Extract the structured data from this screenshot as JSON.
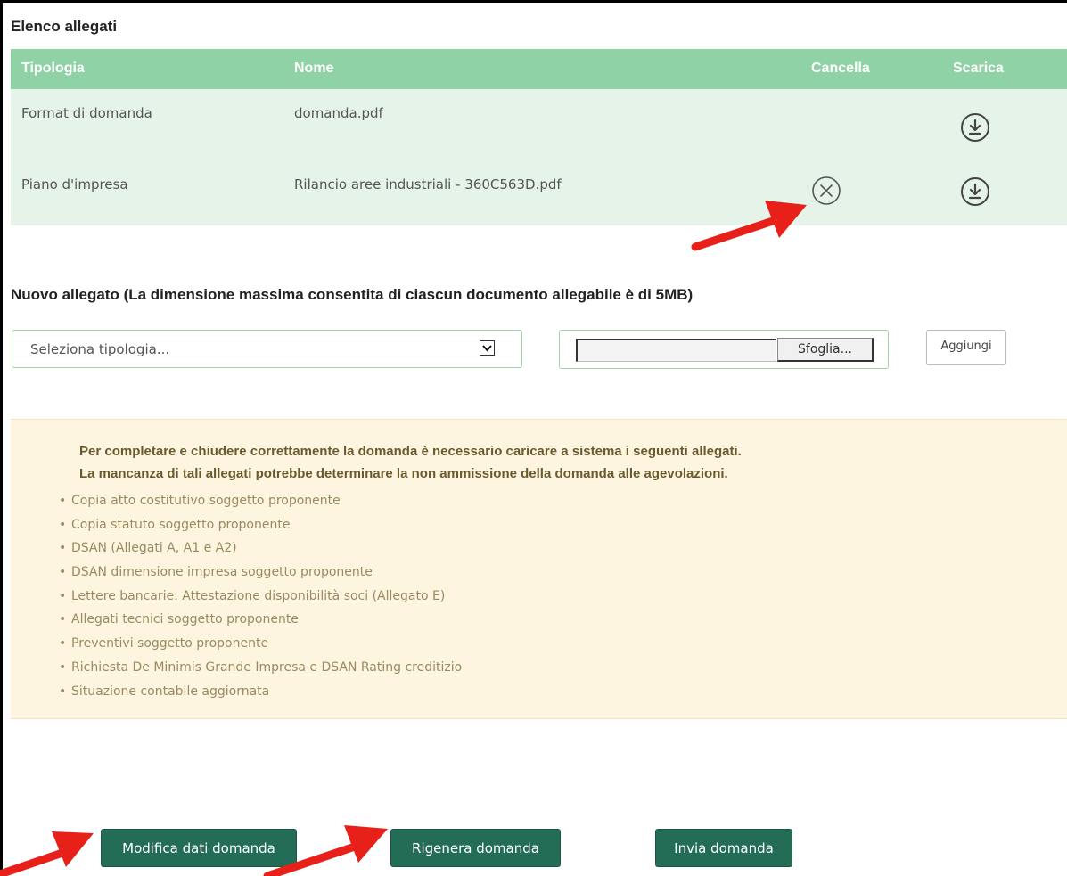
{
  "attachments": {
    "title": "Elenco allegati",
    "columns": [
      "Tipologia",
      "Nome",
      "Cancella",
      "Scarica"
    ],
    "rows": [
      {
        "type": "Format di domanda",
        "name": "domanda.pdf"
      },
      {
        "type": "Piano d'impresa",
        "name": "Rilancio aree industriali - 360C563D.pdf"
      }
    ]
  },
  "new_attachment": {
    "title": "Nuovo allegato (La dimensione massima consentita di ciascun documento allegabile è di 5MB)",
    "select_placeholder": "Seleziona tipologia...",
    "browse_label": "Sfoglia...",
    "add_label": "Aggiungi"
  },
  "notice": {
    "line1": "Per completare e chiudere correttamente la domanda è necessario caricare a sistema i seguenti allegati.",
    "line2": "La mancanza di tali allegati potrebbe determinare la non ammissione della domanda alle agevolazioni.",
    "items": [
      "Copia atto costitutivo soggetto proponente",
      "Copia statuto soggetto proponente",
      "DSAN (Allegati A, A1 e A2)",
      "DSAN dimensione impresa soggetto proponente",
      "Lettere bancarie: Attestazione disponibilità soci (Allegato E)",
      "Allegati tecnici soggetto proponente",
      "Preventivi soggetto proponente",
      "Richiesta De Minimis Grande Impresa e DSAN Rating creditizio",
      "Situazione contabile aggiornata"
    ]
  },
  "actions": {
    "edit_label": "Modifica dati domanda",
    "regenerate_label": "Rigenera domanda",
    "send_label": "Invia domanda"
  },
  "colors": {
    "header_green": "#8fd2a5",
    "row_bg": "#e6f3e9",
    "button_green": "#236d57",
    "notice_bg": "#fdf5e0",
    "arrow_red": "#e8201a"
  },
  "icons": {
    "delete": "circle-x-icon",
    "download": "download-circle-icon",
    "dropdown": "chevron-down-icon"
  }
}
